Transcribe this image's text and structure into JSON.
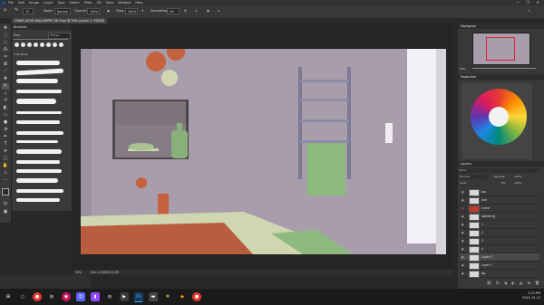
{
  "menubar": {
    "logo": "Ps",
    "items": [
      "File",
      "Edit",
      "Image",
      "Layer",
      "Type",
      "Select",
      "Filter",
      "3D",
      "View",
      "Window",
      "Help"
    ],
    "controls": [
      "—",
      "❐",
      "✕"
    ]
  },
  "options": {
    "size": "75",
    "mode_label": "Mode:",
    "mode": "Normal",
    "opacity_label": "Opacity:",
    "opacity": "100%",
    "flow_label": "Flow:",
    "flow": "100%",
    "smoothing_label": "Smoothing:",
    "smoothing": "0%"
  },
  "tab": {
    "title": "CHAIR JACKE WALLPAPER 06 Final @ 50% (Layer 2, RGB/8)"
  },
  "brushes": {
    "title": "Brushes",
    "size_label": "Size:",
    "size_value": "375 px",
    "folder": "Brushes"
  },
  "navigator": {
    "title": "Navigator",
    "zoom": "50%"
  },
  "swatches": {
    "title": "Swatches"
  },
  "layers": {
    "title": "Layers",
    "kind_label": "Kind",
    "blend": "Normal",
    "opacity_label": "Opacity:",
    "opacity": "100%",
    "lock_label": "Lock:",
    "fill_label": "Fill:",
    "fill": "100%",
    "rows": [
      {
        "name": "top"
      },
      {
        "name": "line"
      },
      {
        "name": "curve"
      },
      {
        "name": "sketching"
      },
      {
        "name": "1"
      },
      {
        "name": "2"
      },
      {
        "name": "3"
      },
      {
        "name": "4"
      },
      {
        "name": "Layer 2"
      },
      {
        "name": "Layer 1"
      },
      {
        "name": "bg"
      }
    ]
  },
  "status": {
    "zoom": "50%",
    "doc": "Doc: 6.59M/125.4M"
  },
  "taskbar": {
    "time": "2:15 PM",
    "date": "2022-12-13"
  },
  "colors": {
    "wall": "#a59aa8",
    "floor_rug": "#b85e3f",
    "towel": "#8fba7f",
    "shelf_bg": "#7b7278",
    "ui_dark": "#282828"
  }
}
